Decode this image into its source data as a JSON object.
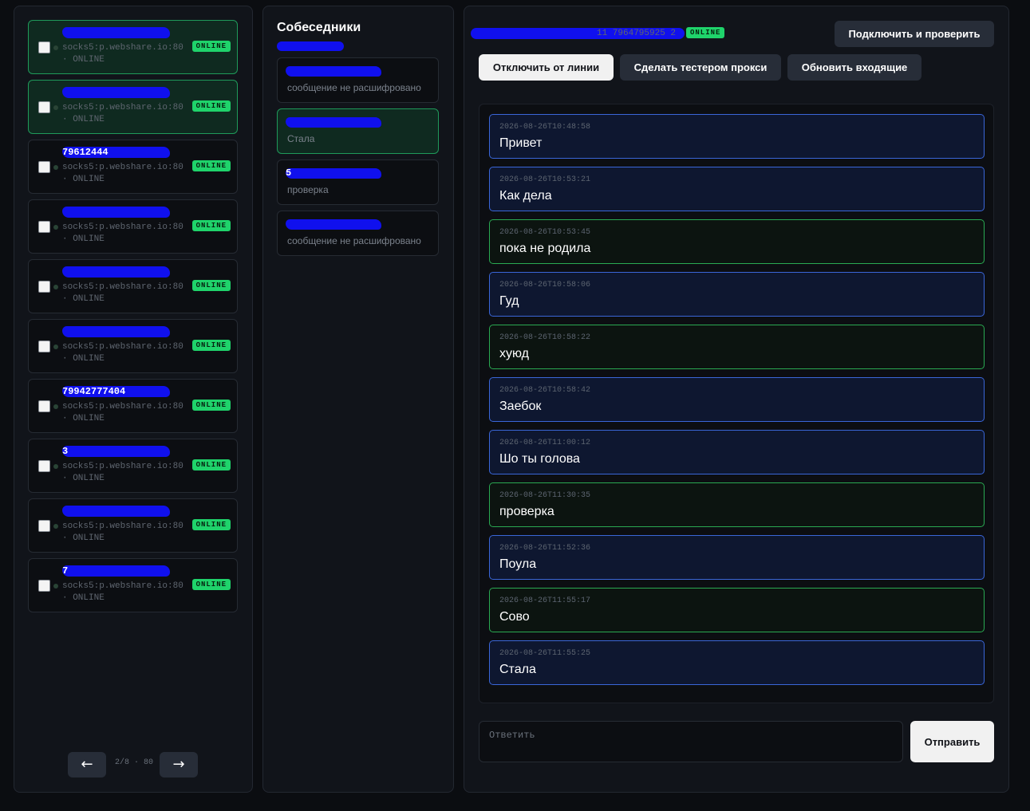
{
  "accounts": {
    "items": [
      {
        "phone": "",
        "proxy": "socks5:p.webshare.io:80",
        "status": "· ONLINE",
        "badge": "ONLINE",
        "active": true
      },
      {
        "phone": "",
        "proxy": "socks5:p.webshare.io:80",
        "status": "· ONLINE",
        "badge": "ONLINE",
        "active": true
      },
      {
        "phone": "79612444",
        "proxy": "socks5:p.webshare.io:80",
        "status": "· ONLINE",
        "badge": "ONLINE",
        "active": false
      },
      {
        "phone": "",
        "proxy": "socks5:p.webshare.io:80",
        "status": "· ONLINE",
        "badge": "ONLINE",
        "active": false
      },
      {
        "phone": "",
        "proxy": "socks5:p.webshare.io:80",
        "status": "· ONLINE",
        "badge": "ONLINE",
        "active": false
      },
      {
        "phone": "",
        "proxy": "socks5:p.webshare.io:80",
        "status": "· ONLINE",
        "badge": "ONLINE",
        "active": false
      },
      {
        "phone": "79942777404",
        "proxy": "socks5:p.webshare.io:80",
        "status": "· ONLINE",
        "badge": "ONLINE",
        "active": false
      },
      {
        "phone": "3",
        "proxy": "socks5:p.webshare.io:80",
        "status": "· ONLINE",
        "badge": "ONLINE",
        "active": false
      },
      {
        "phone": "",
        "proxy": "socks5:p.webshare.io:80",
        "status": "· ONLINE",
        "badge": "ONLINE",
        "active": false
      },
      {
        "phone": "7",
        "proxy": "socks5:p.webshare.io:80",
        "status": "· ONLINE",
        "badge": "ONLINE",
        "active": false
      }
    ],
    "pager": {
      "prev": "←",
      "info": "2/8 · 80",
      "next": "→"
    }
  },
  "contacts": {
    "title": "Собеседники",
    "items": [
      {
        "name": "",
        "preview": "сообщение не расшифровано",
        "active": false
      },
      {
        "name": "",
        "preview": "Стала",
        "active": true
      },
      {
        "name": "5",
        "preview": "проверка",
        "active": false
      },
      {
        "name": "",
        "preview": "сообщение не расшифровано",
        "active": false
      }
    ]
  },
  "chat": {
    "header_meta": "11 7964795925 2",
    "header_badge": "ONLINE",
    "buttons": {
      "connect": "Подключить и проверить",
      "disconnect": "Отключить от линии",
      "set_tester": "Сделать тестером прокси",
      "refresh": "Обновить входящие"
    },
    "messages": [
      {
        "ts": "2026-08-26T10:48:58",
        "text": "Привет",
        "dir": "in"
      },
      {
        "ts": "2026-08-26T10:53:21",
        "text": "Как дела",
        "dir": "in"
      },
      {
        "ts": "2026-08-26T10:53:45",
        "text": "пока не родила",
        "dir": "out"
      },
      {
        "ts": "2026-08-26T10:58:06",
        "text": "Гуд",
        "dir": "in"
      },
      {
        "ts": "2026-08-26T10:58:22",
        "text": "хуюд",
        "dir": "out"
      },
      {
        "ts": "2026-08-26T10:58:42",
        "text": "Заебок",
        "dir": "in"
      },
      {
        "ts": "2026-08-26T11:00:12",
        "text": "Шо ты голова",
        "dir": "in"
      },
      {
        "ts": "2026-08-26T11:30:35",
        "text": "проверка",
        "dir": "out"
      },
      {
        "ts": "2026-08-26T11:52:36",
        "text": "Поула",
        "dir": "in"
      },
      {
        "ts": "2026-08-26T11:55:17",
        "text": "Сово",
        "dir": "out"
      },
      {
        "ts": "2026-08-26T11:55:25",
        "text": "Стала",
        "dir": "in"
      }
    ],
    "reply": {
      "placeholder": "Ответить",
      "value": ""
    },
    "send_label": "Отправить"
  },
  "colors": {
    "online_badge": "#1fd36b",
    "incoming_border": "#3a66d8",
    "outgoing_border": "#2aa952",
    "active_card_border": "#1f9a5a",
    "redaction": "#1010ee"
  }
}
